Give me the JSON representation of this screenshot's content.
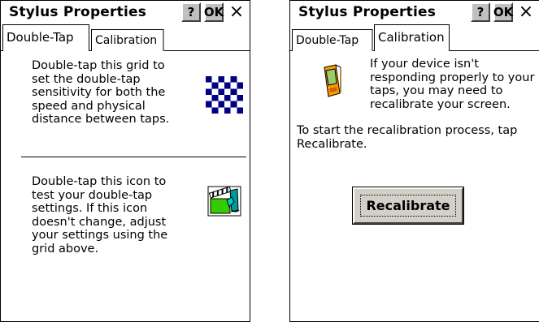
{
  "windows": [
    {
      "title": "Stylus Properties",
      "help_label": "?",
      "ok_label": "OK",
      "close_glyph": "×",
      "tabs": [
        "Double-Tap",
        "Calibration"
      ],
      "active_tab": "Double-Tap",
      "grid_text": "Double-tap this grid to\nset the double-tap\nsensitivity for both the\nspeed and physical\ndistance between taps.",
      "icon_text": "Double-tap this icon to\ntest your double-tap\nsettings. If this icon\ndoesn't change, adjust\nyour settings using the\ngrid above.",
      "icons": [
        "checkerboard-grid-icon",
        "clapperboard-test-icon"
      ],
      "checker_colors": [
        "#000080",
        "#ffffff"
      ]
    },
    {
      "title": "Stylus Properties",
      "help_label": "?",
      "ok_label": "OK",
      "close_glyph": "×",
      "tabs": [
        "Double-Tap",
        "Calibration"
      ],
      "active_tab": "Calibration",
      "device_text": "If your device isn't\nresponding properly to your\ntaps, you may need to\nrecalibrate your screen.",
      "instruction_text": "To start the recalibration process, tap\nRecalibrate.",
      "recalibrate_label": "Recalibrate",
      "icons": [
        "handheld-device-icon"
      ]
    }
  ]
}
